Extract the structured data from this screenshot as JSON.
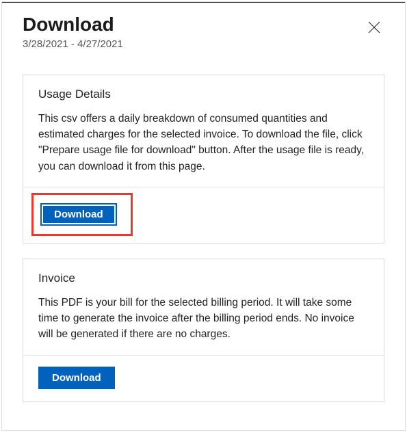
{
  "header": {
    "title": "Download",
    "dateRange": "3/28/2021 - 4/27/2021"
  },
  "cards": {
    "usageDetails": {
      "title": "Usage Details",
      "description": "This csv offers a daily breakdown of consumed quantities and estimated charges for the selected invoice. To download the file, click \"Prepare usage file for download\" button. After the usage file is ready, you can download it from this page.",
      "buttonLabel": "Download"
    },
    "invoice": {
      "title": "Invoice",
      "description": "This PDF is your bill for the selected billing period. It will take some time to generate the invoice after the billing period ends. No invoice will be generated if there are no charges.",
      "buttonLabel": "Download"
    }
  }
}
